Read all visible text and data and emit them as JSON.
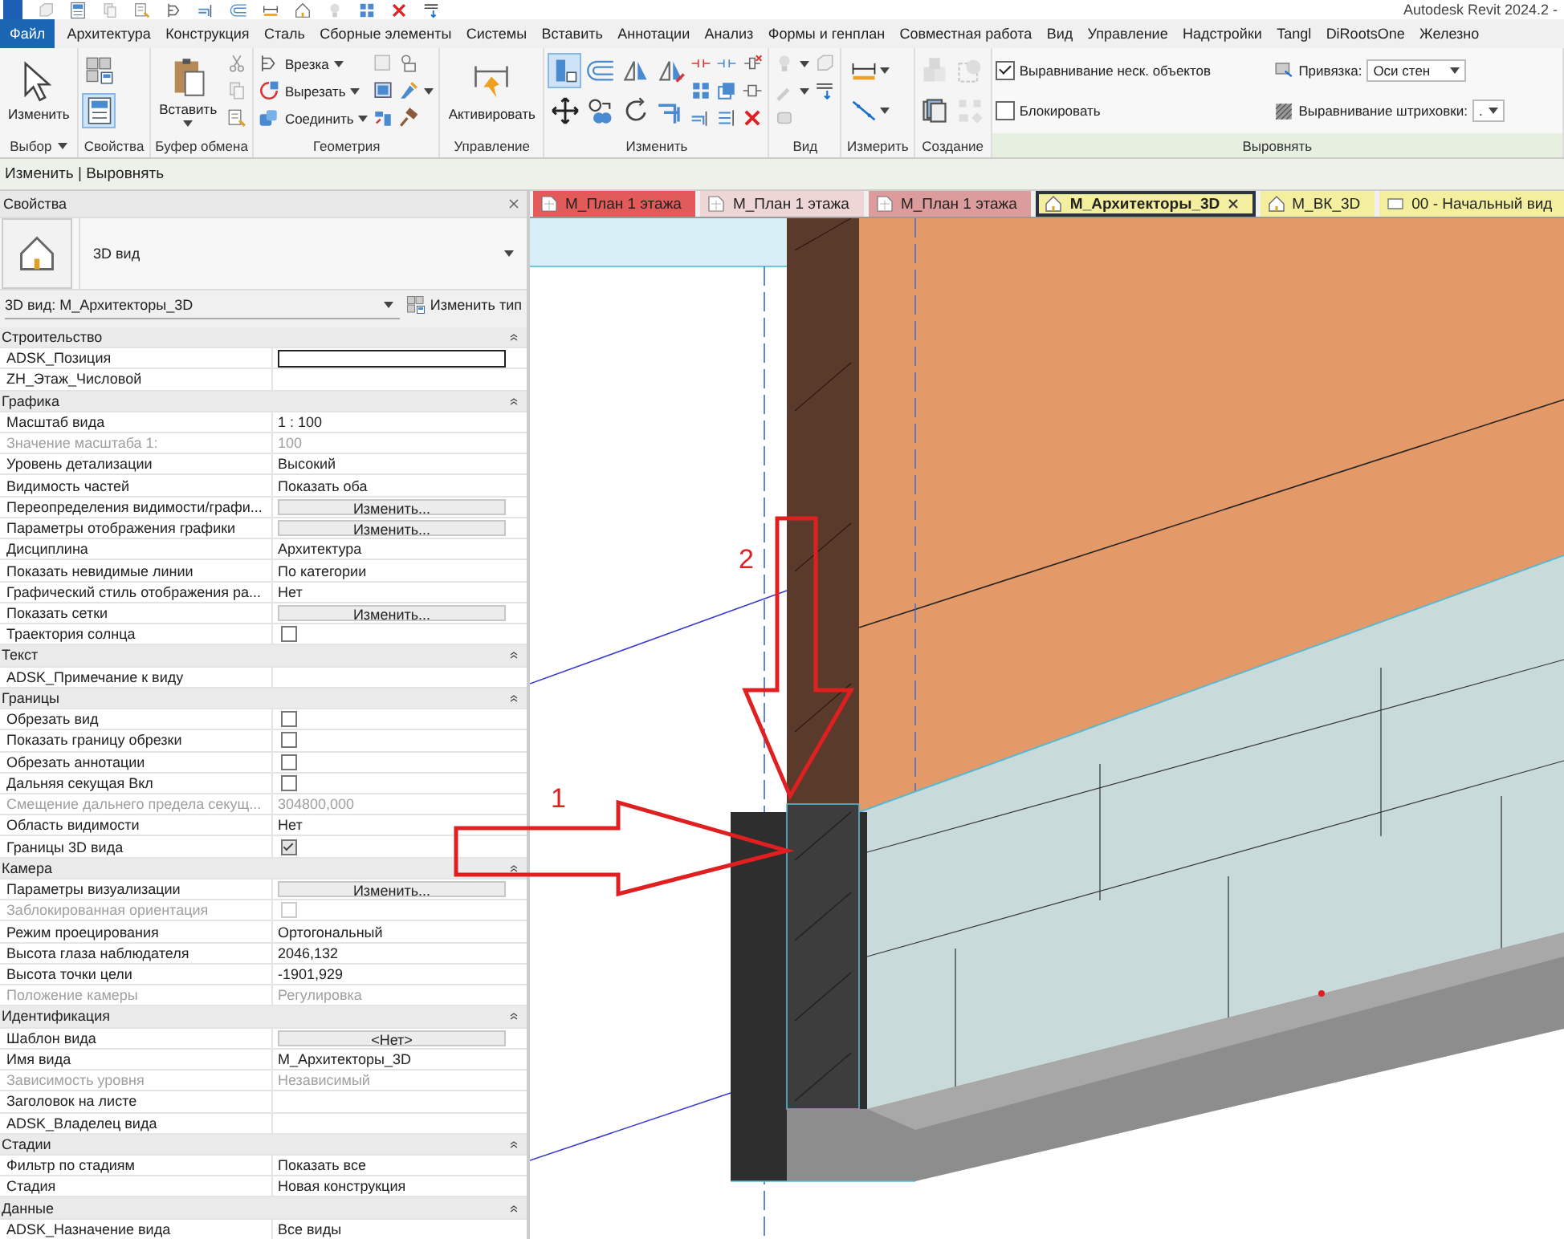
{
  "title_bar": {
    "title": "Autodesk Revit 2024.2 -"
  },
  "menu_tabs": [
    {
      "kind": "file",
      "label": "Файл"
    },
    {
      "kind": "tab",
      "label": "Архитектура"
    },
    {
      "kind": "tab",
      "label": "Конструкция"
    },
    {
      "kind": "tab",
      "label": "Сталь"
    },
    {
      "kind": "tab",
      "label": "Сборные элементы"
    },
    {
      "kind": "tab",
      "label": "Системы"
    },
    {
      "kind": "tab",
      "label": "Вставить"
    },
    {
      "kind": "tab",
      "label": "Аннотации"
    },
    {
      "kind": "tab",
      "label": "Анализ"
    },
    {
      "kind": "tab",
      "label": "Формы и генплан"
    },
    {
      "kind": "tab",
      "label": "Совместная работа"
    },
    {
      "kind": "tab",
      "label": "Вид"
    },
    {
      "kind": "tab",
      "label": "Управление"
    },
    {
      "kind": "tab",
      "label": "Надстройки"
    },
    {
      "kind": "tab",
      "label": "Tangl"
    },
    {
      "kind": "tab",
      "label": "DiRootsOne"
    },
    {
      "kind": "tab",
      "label": "Железно"
    }
  ],
  "ribbon": {
    "panels": [
      {
        "title": "Выбор",
        "menu": true,
        "tools": [
          {
            "kind": "large",
            "label": "Изменить"
          }
        ]
      },
      {
        "title": "Свойства",
        "tools": [
          {
            "kind": "medium",
            "on": false
          },
          {
            "kind": "medium",
            "on": true
          }
        ]
      },
      {
        "title": "Буфер обмена",
        "tools": [
          {
            "kind": "large",
            "label": "Вставить",
            "menu": true
          },
          {
            "kind": "small"
          },
          {
            "kind": "small"
          },
          {
            "kind": "small"
          }
        ]
      },
      {
        "title": "Геометрия",
        "tools": [
          {
            "kind": "small",
            "label": "Врезка",
            "menu": true
          },
          {
            "kind": "small",
            "label": "Вырезать",
            "menu": true
          },
          {
            "kind": "small",
            "label": "Соединить",
            "menu": true
          },
          {
            "kind": "small"
          },
          {
            "kind": "small"
          },
          {
            "kind": "small"
          },
          {
            "kind": "small"
          },
          {
            "kind": "small",
            "menu": true
          },
          {
            "kind": "small"
          }
        ]
      },
      {
        "title": "Управление",
        "tools": [
          {
            "kind": "large",
            "label": "Активировать"
          }
        ]
      },
      {
        "title": "Изменить",
        "tools": [
          {
            "kind": "medium",
            "on": true
          },
          {
            "kind": "medium",
            "on": false
          },
          {
            "kind": "medium",
            "on": false
          },
          {
            "kind": "medium",
            "on": false
          },
          {
            "kind": "medium",
            "on": false
          },
          {
            "kind": "medium",
            "on": false
          },
          {
            "kind": "medium",
            "on": false
          },
          {
            "kind": "medium",
            "on": false
          },
          {
            "kind": "small"
          },
          {
            "kind": "small"
          },
          {
            "kind": "small"
          },
          {
            "kind": "small"
          },
          {
            "kind": "small"
          },
          {
            "kind": "small"
          },
          {
            "kind": "small"
          },
          {
            "kind": "small"
          },
          {
            "kind": "small"
          }
        ]
      },
      {
        "title": "Вид",
        "tools": [
          {
            "kind": "small",
            "menu": true
          },
          {
            "kind": "small",
            "menu": true
          },
          {
            "kind": "small"
          },
          {
            "kind": "small"
          },
          {
            "kind": "small"
          }
        ]
      },
      {
        "title": "Измерить",
        "tools": [
          {
            "kind": "medium",
            "menu": true,
            "on": false
          },
          {
            "kind": "medium",
            "menu": true,
            "on": false
          }
        ]
      },
      {
        "title": "Создание",
        "tools": [
          {
            "kind": "medium",
            "on": false
          },
          {
            "kind": "medium",
            "on": false
          },
          {
            "kind": "medium",
            "on": false
          },
          {
            "kind": "medium",
            "on": false
          }
        ]
      },
      {
        "title": "Выровнять",
        "active": true,
        "tools": [
          {
            "kind": "check",
            "label": "Выравнивание неск. объектов",
            "checked": true
          },
          {
            "kind": "check",
            "label": "Блокировать",
            "checked": false
          },
          {
            "kind": "combo",
            "label": "Привязка:",
            "value": "Оси стен"
          },
          {
            "kind": "combo",
            "label": "Выравнивание штриховки:",
            "value": "."
          }
        ]
      }
    ]
  },
  "options_bar": {
    "text": "Изменить | Выровнять"
  },
  "properties": {
    "title": "Свойства",
    "type_name": "3D вид",
    "instance": "3D вид: М_Архитекторы_3D",
    "edit_type": "Изменить тип",
    "rows": [
      {
        "kind": "group",
        "label": "Строительство",
        "expanded": true
      },
      {
        "kind": "input",
        "label": "ADSK_Позиция",
        "disabled": false
      },
      {
        "kind": "text",
        "label": "ZH_Этаж_Числовой",
        "disabled": false
      },
      {
        "kind": "group",
        "label": "Графика",
        "expanded": true
      },
      {
        "kind": "text",
        "label": "Масштаб вида",
        "value": "1 : 100",
        "disabled": false
      },
      {
        "kind": "text",
        "label": "Значение масштаба    1:",
        "value": "100",
        "disabled": true
      },
      {
        "kind": "text",
        "label": "Уровень детализации",
        "value": "Высокий",
        "disabled": false
      },
      {
        "kind": "text",
        "label": "Видимость частей",
        "value": "Показать оба",
        "disabled": false
      },
      {
        "kind": "button",
        "label": "Переопределения видимости/графи...",
        "value": "Изменить...",
        "disabled": false
      },
      {
        "kind": "button",
        "label": "Параметры отображения графики",
        "value": "Изменить...",
        "disabled": false
      },
      {
        "kind": "text",
        "label": "Дисциплина",
        "value": "Архитектура",
        "disabled": false
      },
      {
        "kind": "text",
        "label": "Показать невидимые линии",
        "value": "По категории",
        "disabled": false
      },
      {
        "kind": "text",
        "label": "Графический стиль отображения ра...",
        "value": "Нет",
        "disabled": false
      },
      {
        "kind": "button",
        "label": "Показать сетки",
        "value": "Изменить...",
        "disabled": false
      },
      {
        "kind": "check",
        "label": "Траектория солнца",
        "checked": false,
        "disabled": false
      },
      {
        "kind": "group",
        "label": "Текст",
        "expanded": true
      },
      {
        "kind": "text",
        "label": "ADSK_Примечание к виду",
        "disabled": false
      },
      {
        "kind": "group",
        "label": "Границы",
        "expanded": true
      },
      {
        "kind": "check",
        "label": "Обрезать вид",
        "checked": false,
        "disabled": false
      },
      {
        "kind": "check",
        "label": "Показать границу обрезки",
        "checked": false,
        "disabled": false
      },
      {
        "kind": "check",
        "label": "Обрезать аннотации",
        "checked": false,
        "disabled": false
      },
      {
        "kind": "check",
        "label": "Дальняя секущая Вкл",
        "checked": false,
        "disabled": false
      },
      {
        "kind": "text",
        "label": "Смещение дальнего предела секущ...",
        "value": "304800,000",
        "disabled": true
      },
      {
        "kind": "text",
        "label": "Область видимости",
        "value": "Нет",
        "disabled": false
      },
      {
        "kind": "check",
        "label": "Границы 3D вида",
        "checked": true,
        "disabled": false
      },
      {
        "kind": "group",
        "label": "Камера",
        "expanded": true
      },
      {
        "kind": "button",
        "label": "Параметры визуализации",
        "value": "Изменить...",
        "disabled": false
      },
      {
        "kind": "check",
        "label": "Заблокированная ориентация",
        "checked": false,
        "disabled": true
      },
      {
        "kind": "text",
        "label": "Режим проецирования",
        "value": "Ортогональный",
        "disabled": false
      },
      {
        "kind": "text",
        "label": "Высота глаза наблюдателя",
        "value": "2046,132",
        "disabled": false
      },
      {
        "kind": "text",
        "label": "Высота точки цели",
        "value": "-1901,929",
        "disabled": false
      },
      {
        "kind": "text",
        "label": "Положение камеры",
        "value": "Регулировка",
        "disabled": true
      },
      {
        "kind": "group",
        "label": "Идентификация",
        "expanded": true
      },
      {
        "kind": "button",
        "label": "Шаблон вида",
        "value": "<Нет>",
        "disabled": false
      },
      {
        "kind": "text",
        "label": "Имя вида",
        "value": "М_Архитекторы_3D",
        "disabled": false
      },
      {
        "kind": "text",
        "label": "Зависимость уровня",
        "value": "Независимый",
        "disabled": true
      },
      {
        "kind": "text",
        "label": "Заголовок на листе",
        "disabled": false
      },
      {
        "kind": "text",
        "label": "ADSK_Владелец вида",
        "disabled": false
      },
      {
        "kind": "group",
        "label": "Стадии",
        "expanded": true
      },
      {
        "kind": "text",
        "label": "Фильтр по стадиям",
        "value": "Показать все",
        "disabled": false
      },
      {
        "kind": "text",
        "label": "Стадия",
        "value": "Новая конструкция",
        "disabled": false
      },
      {
        "kind": "group",
        "label": "Данные",
        "expanded": true
      },
      {
        "kind": "text",
        "label": "ADSK_Назначение вида",
        "value": "Все виды",
        "disabled": false
      }
    ]
  },
  "view_tabs": [
    {
      "kind": "plan",
      "label": "М_План 1 этажа",
      "color": "#e35a5a",
      "selected": false
    },
    {
      "kind": "plan",
      "label": "М_План 1 этажа",
      "color": "#eed6d6",
      "selected": false
    },
    {
      "kind": "plan",
      "label": "М_План 1 этажа",
      "color": "#dc9c9c",
      "selected": false
    },
    {
      "kind": "model",
      "label": "М_Архитекторы_3D",
      "color": "#f3ef9f",
      "selected": true
    },
    {
      "kind": "model",
      "label": "М_ВК_3D",
      "color": "#f3ef9f",
      "selected": false
    },
    {
      "kind": "sheet",
      "label": "00 - Начальный вид",
      "color": "#f3ef9f",
      "selected": false
    }
  ],
  "annotations": [
    {
      "label": "1"
    },
    {
      "label": "2"
    }
  ]
}
